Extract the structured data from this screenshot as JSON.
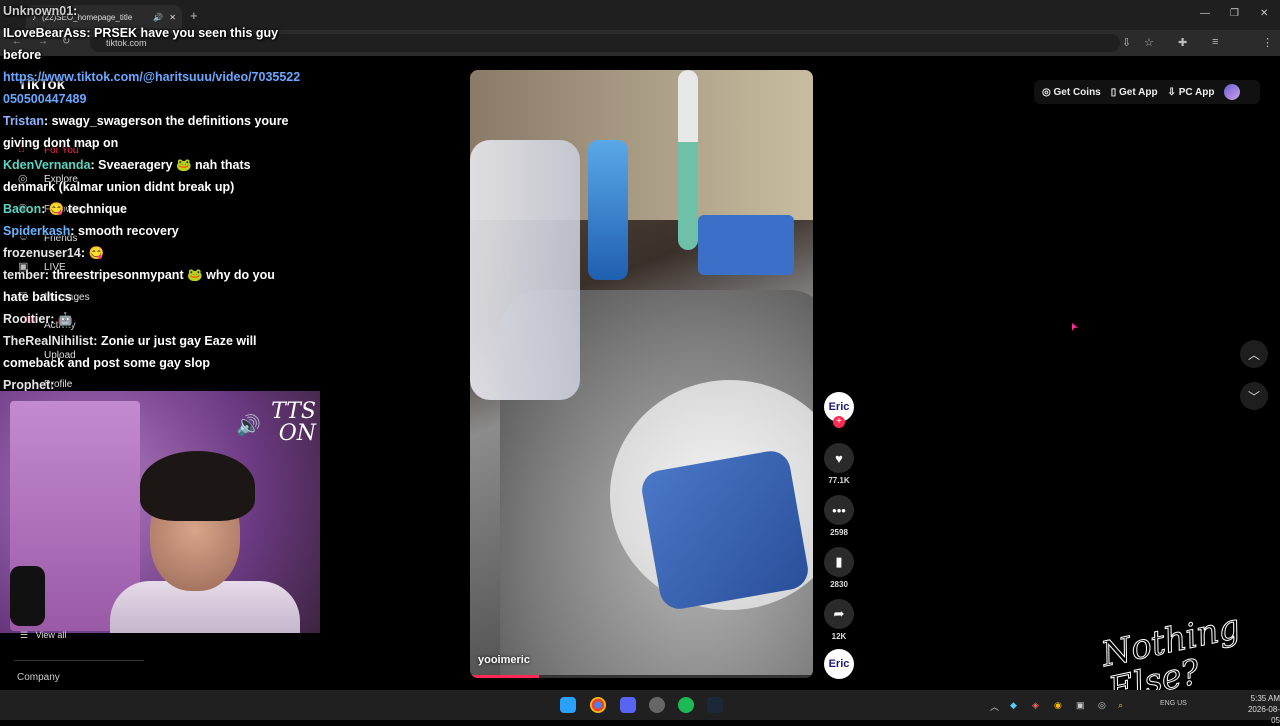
{
  "browser": {
    "tab_title": "(22)SEO_homepage_title",
    "new_tab": "+",
    "url": "tiktok.com",
    "window_controls": [
      "—",
      "❐",
      "✕"
    ]
  },
  "tiktok": {
    "brand": "TikTok",
    "header": {
      "coins": "Get Coins",
      "app": "Get App",
      "pc_app": "PC App"
    },
    "sidebar": [
      "For You",
      "Explore",
      "Following",
      "Friends",
      "LIVE",
      "Messages",
      "Activity",
      "Upload",
      "Profile"
    ],
    "activity_badge": "12",
    "view_all": "View all",
    "company": "Company",
    "video": {
      "author": "yooimeric",
      "progress": 0.2
    },
    "actions": {
      "author_avatar": "Eric",
      "follow": "+",
      "likes": "77.1K",
      "comments": "2598",
      "saves": "2830",
      "shares": "12K"
    }
  },
  "chat": [
    {
      "user": "Unknown01",
      "text": "",
      "cls": "u1"
    },
    {
      "user": "ILoveBearAss",
      "text": "PRSEK have you seen this guy before",
      "cls": "u2"
    },
    {
      "user": "",
      "text": "https://www.tiktok.com/@haritsuuu/video/7035522050500447489",
      "cls": "link"
    },
    {
      "user": "Tristan",
      "text": "swagy_swagerson the definitions youre giving dont map on",
      "cls": "u3"
    },
    {
      "user": "KdenVernanda",
      "text": "Sveaeragery 🐸 nah thats denmark (kalmar union didnt break up)",
      "cls": "u4"
    },
    {
      "user": "Bacon",
      "text": "😋 technique",
      "cls": "u4"
    },
    {
      "user": "Spiderkash",
      "text": "smooth recovery",
      "cls": "u5"
    },
    {
      "user": "frozenuser14",
      "text": "😋",
      "cls": "u6"
    },
    {
      "user": "tember",
      "text": "threestripesonmypant 🐸 why do you hate baltics",
      "cls": "u6"
    },
    {
      "user": "Rooitier",
      "text": "🤖",
      "cls": "u6"
    },
    {
      "user": "TheRealNihilist",
      "text": "Zonie ur just gay Eaze will comeback and post some gay slop",
      "cls": "u6"
    },
    {
      "user": "Prophet",
      "text": "",
      "cls": "u6"
    }
  ],
  "webcam": {
    "tts_label": "TTS ON"
  },
  "overlay_logo": "Nothing Else?",
  "taskbar": {
    "lang": "ENG US",
    "time": "5:35 AM",
    "date": "2026-08-05"
  },
  "colors": {
    "accent": "#fe2c55",
    "background": "#000000"
  }
}
